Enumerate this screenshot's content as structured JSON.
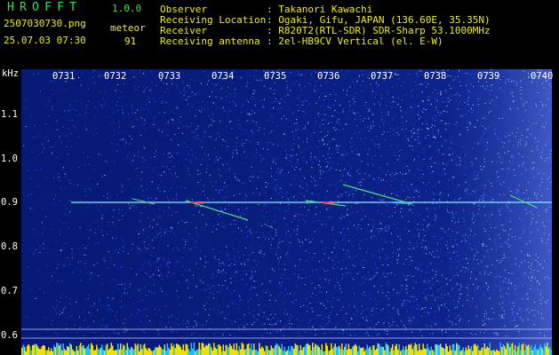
{
  "app": {
    "title": "HROFFT",
    "version": "1.0.0"
  },
  "file": {
    "name": "2507030730.png",
    "datetime": "25.07.03 07:30"
  },
  "meteor": {
    "label": "meteor",
    "count": "91"
  },
  "info": [
    {
      "key": "Observer",
      "value": ": Takanori Kawachi"
    },
    {
      "key": "Receiving Location",
      "value": ": Ogaki, Gifu, JAPAN (136.60E, 35.35N)"
    },
    {
      "key": "Receiver",
      "value": ": R820T2(RTL-SDR) SDR-Sharp 53.1000MHz"
    },
    {
      "key": "Receiving antenna",
      "value": ": 2el-HB9CV Vertical (el. E-W)"
    }
  ],
  "axis": {
    "unit": "kHz",
    "frequency_ticks": [
      "1.1",
      "1.0",
      "0.9",
      "0.8",
      "0.7",
      "0.6"
    ],
    "time_ticks": [
      "0731",
      "0732",
      "0733",
      "0734",
      "0735",
      "0736",
      "0737",
      "0738",
      "0739",
      "0740"
    ]
  },
  "colors": {
    "background": "#071a78",
    "carrier": "#7ff0ff",
    "header_green": "#33e04a",
    "header_yellow": "#f0f000"
  }
}
